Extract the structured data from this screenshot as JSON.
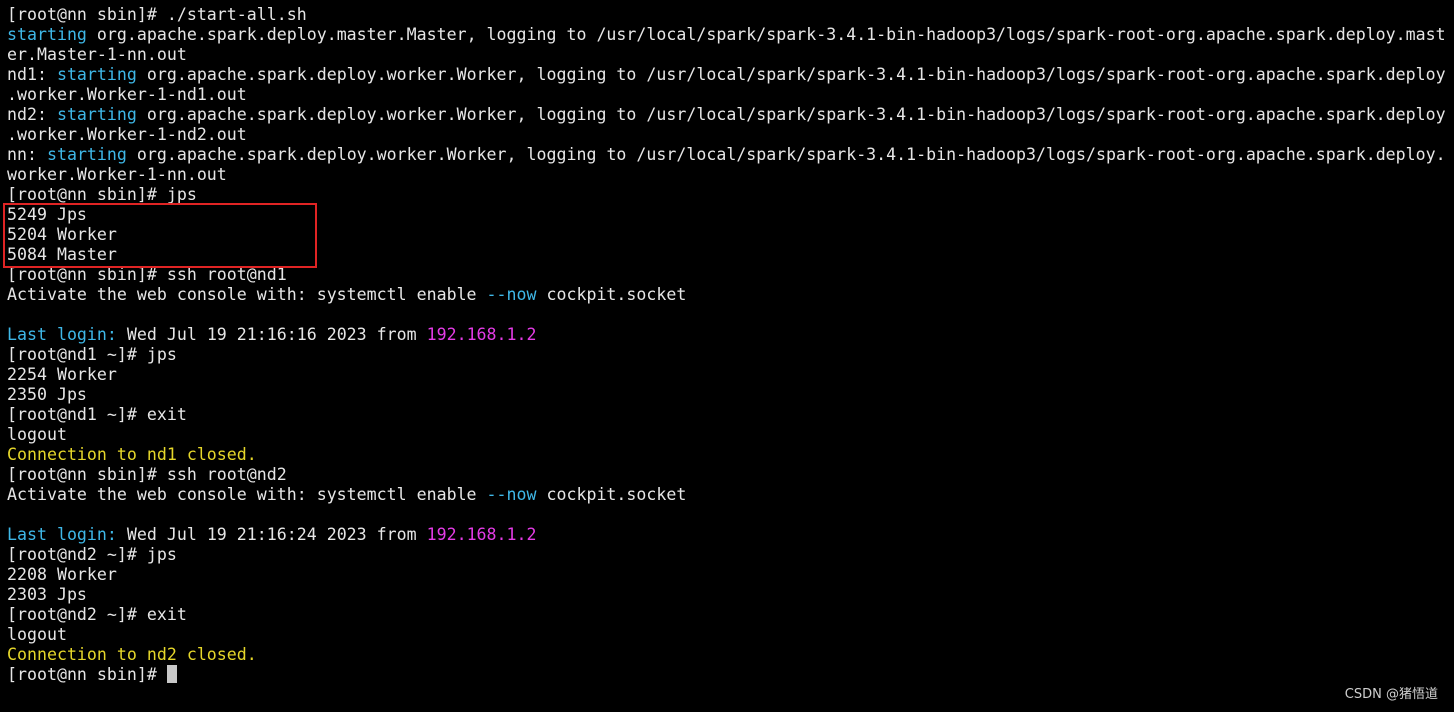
{
  "colors": {
    "background": "#000000",
    "text": "#e6e6e6",
    "keyword_blue": "#3fb8e8",
    "ip_magenta": "#e43ce6",
    "closed_yellow": "#e6d72a",
    "highlight_border": "#e02424",
    "cursor": "#c8c8c8"
  },
  "terminal": {
    "lines": [
      [
        {
          "t": "[root@nn sbin]# ./start-all.sh",
          "c": "default"
        }
      ],
      [
        {
          "t": "starting",
          "c": "blue"
        },
        {
          "t": " org.apache.spark.deploy.master.Master, logging to /usr/local/spark/spark-3.4.1-bin-hadoop3/logs/spark-root-org.apache.spark.deploy.mast",
          "c": "default"
        }
      ],
      [
        {
          "t": "er.Master-1-nn.out",
          "c": "default"
        }
      ],
      [
        {
          "t": "nd1: ",
          "c": "default"
        },
        {
          "t": "starting",
          "c": "blue"
        },
        {
          "t": " org.apache.spark.deploy.worker.Worker, logging to /usr/local/spark/spark-3.4.1-bin-hadoop3/logs/spark-root-org.apache.spark.deploy",
          "c": "default"
        }
      ],
      [
        {
          "t": ".worker.Worker-1-nd1.out",
          "c": "default"
        }
      ],
      [
        {
          "t": "nd2: ",
          "c": "default"
        },
        {
          "t": "starting",
          "c": "blue"
        },
        {
          "t": " org.apache.spark.deploy.worker.Worker, logging to /usr/local/spark/spark-3.4.1-bin-hadoop3/logs/spark-root-org.apache.spark.deploy",
          "c": "default"
        }
      ],
      [
        {
          "t": ".worker.Worker-1-nd2.out",
          "c": "default"
        }
      ],
      [
        {
          "t": "nn: ",
          "c": "default"
        },
        {
          "t": "starting",
          "c": "blue"
        },
        {
          "t": " org.apache.spark.deploy.worker.Worker, logging to /usr/local/spark/spark-3.4.1-bin-hadoop3/logs/spark-root-org.apache.spark.deploy.",
          "c": "default"
        }
      ],
      [
        {
          "t": "worker.Worker-1-nn.out",
          "c": "default"
        }
      ],
      [
        {
          "t": "[root@nn sbin]# jps",
          "c": "default"
        }
      ],
      [
        {
          "t": "5249 Jps",
          "c": "default"
        }
      ],
      [
        {
          "t": "5204 Worker",
          "c": "default"
        }
      ],
      [
        {
          "t": "5084 Master",
          "c": "default"
        }
      ],
      [
        {
          "t": "[root@nn sbin]# ssh root@nd1",
          "c": "default"
        }
      ],
      [
        {
          "t": "Activate the web console with: systemctl enable ",
          "c": "default"
        },
        {
          "t": "--now",
          "c": "blue"
        },
        {
          "t": " cockpit.socket",
          "c": "default"
        }
      ],
      [],
      [
        {
          "t": "Last login:",
          "c": "blue"
        },
        {
          "t": " Wed Jul 19 21:16:16 2023 from ",
          "c": "default"
        },
        {
          "t": "192.168.1.2",
          "c": "magenta"
        }
      ],
      [
        {
          "t": "[root@nd1 ~]# jps",
          "c": "default"
        }
      ],
      [
        {
          "t": "2254 Worker",
          "c": "default"
        }
      ],
      [
        {
          "t": "2350 Jps",
          "c": "default"
        }
      ],
      [
        {
          "t": "[root@nd1 ~]# exit",
          "c": "default"
        }
      ],
      [
        {
          "t": "logout",
          "c": "default"
        }
      ],
      [
        {
          "t": "Connection to nd1 closed.",
          "c": "yellow"
        }
      ],
      [
        {
          "t": "[root@nn sbin]# ssh root@nd2",
          "c": "default"
        }
      ],
      [
        {
          "t": "Activate the web console with: systemctl enable ",
          "c": "default"
        },
        {
          "t": "--now",
          "c": "blue"
        },
        {
          "t": " cockpit.socket",
          "c": "default"
        }
      ],
      [],
      [
        {
          "t": "Last login:",
          "c": "blue"
        },
        {
          "t": " Wed Jul 19 21:16:24 2023 from ",
          "c": "default"
        },
        {
          "t": "192.168.1.2",
          "c": "magenta"
        }
      ],
      [
        {
          "t": "[root@nd2 ~]# jps",
          "c": "default"
        }
      ],
      [
        {
          "t": "2208 Worker",
          "c": "default"
        }
      ],
      [
        {
          "t": "2303 Jps",
          "c": "default"
        }
      ],
      [
        {
          "t": "[root@nd2 ~]# exit",
          "c": "default"
        }
      ],
      [
        {
          "t": "logout",
          "c": "default"
        }
      ],
      [
        {
          "t": "Connection to nd2 closed.",
          "c": "yellow"
        }
      ],
      [
        {
          "t": "[root@nn sbin]# ",
          "c": "default"
        }
      ]
    ]
  },
  "watermark": "CSDN @猪悟道"
}
